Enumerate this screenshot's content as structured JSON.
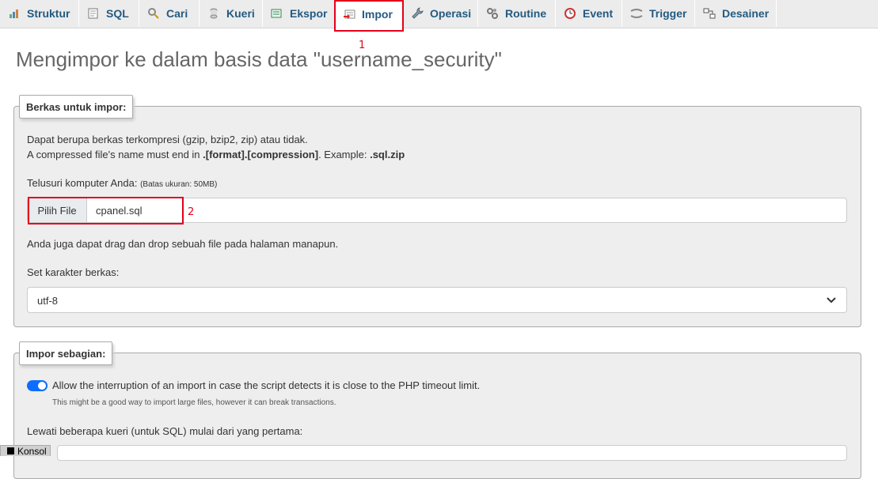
{
  "tabs": [
    {
      "label": "Struktur",
      "icon": "structure-icon"
    },
    {
      "label": "SQL",
      "icon": "sql-icon"
    },
    {
      "label": "Cari",
      "icon": "search-icon"
    },
    {
      "label": "Kueri",
      "icon": "query-icon"
    },
    {
      "label": "Ekspor",
      "icon": "export-icon"
    },
    {
      "label": "Impor",
      "icon": "import-icon",
      "active": true
    },
    {
      "label": "Operasi",
      "icon": "wrench-icon"
    },
    {
      "label": "Routine",
      "icon": "routine-icon"
    },
    {
      "label": "Event",
      "icon": "clock-icon"
    },
    {
      "label": "Trigger",
      "icon": "trigger-icon"
    },
    {
      "label": "Desainer",
      "icon": "designer-icon"
    }
  ],
  "annotations": {
    "one": "1",
    "two": "2"
  },
  "page_title": "Mengimpor ke dalam basis data \"username_security\"",
  "file_section": {
    "legend": "Berkas untuk impor:",
    "line1": "Dapat berupa berkas terkompresi (gzip, bzip2, zip) atau tidak.",
    "line2_a": "A compressed file's name must end in ",
    "line2_b": ".[format].[compression]",
    "line2_c": ". Example: ",
    "line2_d": ".sql.zip",
    "browse_label": "Telusuri komputer Anda: ",
    "size_limit": "(Batas ukuran: 50MB)",
    "choose_button": "Pilih File",
    "file_name": "cpanel.sql",
    "drag_hint": "Anda juga dapat drag dan drop sebuah file pada halaman manapun.",
    "charset_label": "Set karakter berkas:",
    "charset_value": "utf-8"
  },
  "partial_section": {
    "legend": "Impor sebagian:",
    "allow_interrupt": "Allow the interruption of an import in case the script detects it is close to the PHP timeout limit.",
    "allow_interrupt_hint": "This might be a good way to import large files, however it can break transactions.",
    "skip_label": "Lewati beberapa kueri (untuk SQL) mulai dari yang pertama:"
  },
  "console_label": "Konsol",
  "colors": {
    "link": "#235a81",
    "annotation": "#e3001b",
    "toggle": "#0d6efd"
  }
}
